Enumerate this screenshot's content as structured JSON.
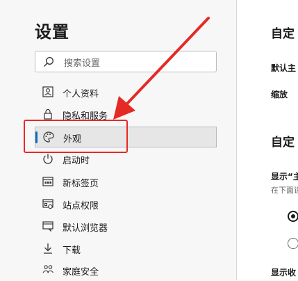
{
  "sidebar": {
    "title": "设置",
    "search_placeholder": "搜索设置",
    "items": [
      {
        "label": "个人资料",
        "icon": "profile-icon"
      },
      {
        "label": "隐私和服务",
        "icon": "lock-icon"
      },
      {
        "label": "外观",
        "icon": "palette-icon",
        "selected": true
      },
      {
        "label": "启动时",
        "icon": "power-icon"
      },
      {
        "label": "新标签页",
        "icon": "new-tab-icon"
      },
      {
        "label": "站点权限",
        "icon": "site-permissions-icon"
      },
      {
        "label": "默认浏览器",
        "icon": "default-browser-icon"
      },
      {
        "label": "下载",
        "icon": "download-icon"
      },
      {
        "label": "家庭安全",
        "icon": "family-icon"
      }
    ]
  },
  "main": {
    "heading1": "自定",
    "row_default": "默认主",
    "row_zoom": "缩放",
    "heading2": "自定",
    "show_label": "显示“主",
    "hint": "在下面设",
    "show_label2": "显示收"
  },
  "annotation": {
    "color": "#e52a25"
  },
  "accent_color": "#0f6cbd"
}
